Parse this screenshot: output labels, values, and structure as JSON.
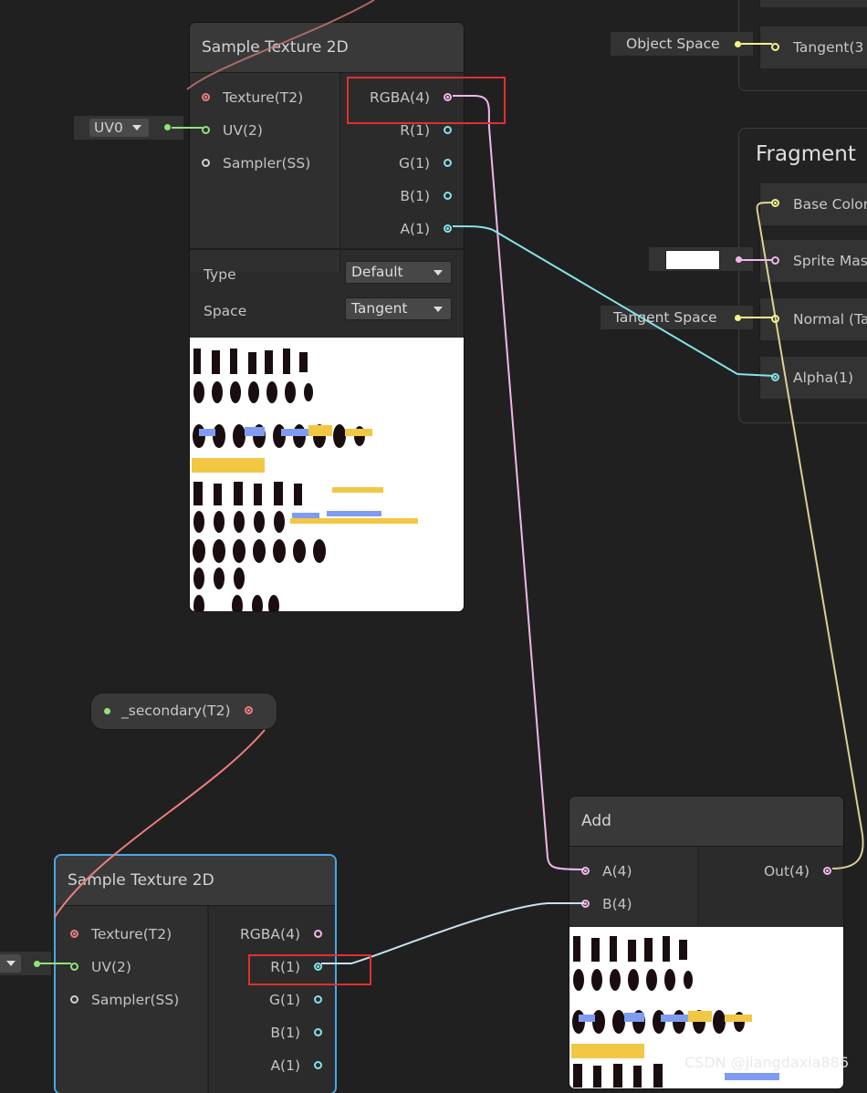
{
  "node1": {
    "title": "Sample Texture 2D",
    "inputs": [
      "Texture(T2)",
      "UV(2)",
      "Sampler(SS)"
    ],
    "outputs": [
      "RGBA(4)",
      "R(1)",
      "G(1)",
      "B(1)",
      "A(1)"
    ],
    "type_label": "Type",
    "type_value": "Default",
    "space_label": "Space",
    "space_value": "Tangent"
  },
  "uv_chip": {
    "value": "UV0"
  },
  "node2": {
    "title": "Sample Texture 2D",
    "inputs": [
      "Texture(T2)",
      "UV(2)",
      "Sampler(SS)"
    ],
    "outputs": [
      "RGBA(4)",
      "R(1)",
      "G(1)",
      "B(1)",
      "A(1)"
    ]
  },
  "property_node": {
    "label": "_secondary(T2)"
  },
  "add_node": {
    "title": "Add",
    "inputs": [
      "A(4)",
      "B(4)"
    ],
    "outputs": [
      "Out(4)"
    ]
  },
  "vertex_partial": {
    "object_space_chip": "Object Space",
    "slot": "Tangent(3"
  },
  "fragment": {
    "title": "Fragment",
    "slots": [
      "Base Color",
      "Sprite Mas",
      "Normal (Ta",
      "Alpha(1)"
    ],
    "tangent_space_chip": "Tangent Space"
  },
  "watermark": "CSDN @jiangdaxia886",
  "colors": {
    "texture_port": "#ee7d7d",
    "uv_port": "#92e27a",
    "vector4_port": "#f2b6ea",
    "vector1_port": "#86e3e8",
    "vector3_port": "#f3f38a",
    "selection": "#4aa8e6",
    "highlight_box": "#e03030"
  }
}
